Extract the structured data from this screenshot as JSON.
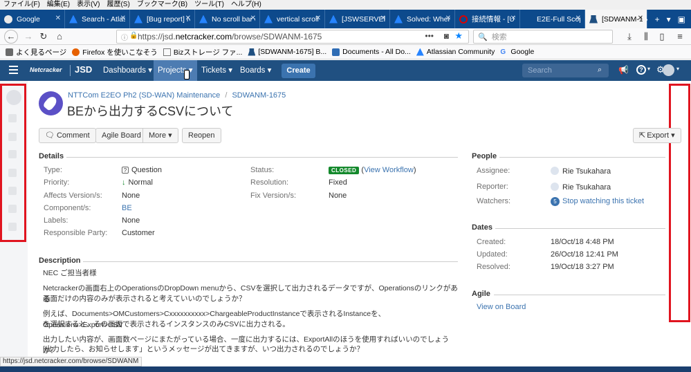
{
  "browser": {
    "menu": [
      "ファイル(F)",
      "編集(E)",
      "表示(V)",
      "履歴(S)",
      "ブックマーク(B)",
      "ツール(T)",
      "ヘルプ(H)"
    ],
    "tabs": [
      {
        "title": "Google",
        "icon": "google-icon"
      },
      {
        "title": "Search - Atlassi",
        "icon": "atlassian-icon"
      },
      {
        "title": "[Bug report] N",
        "icon": "atlassian-icon"
      },
      {
        "title": "No scroll bar or",
        "icon": "atlassian-icon"
      },
      {
        "title": "vertical scroll b",
        "icon": "atlassian-icon"
      },
      {
        "title": "[JSWSERVER-1",
        "icon": "atlassian-icon"
      },
      {
        "title": "Solved: Where'",
        "icon": "atlassian-icon"
      },
      {
        "title": "接続情報 - [UT",
        "icon": "red-circle-icon"
      },
      {
        "title": "E2E-Full Scope",
        "icon": "e2e-icon"
      },
      {
        "title": "[SDWANM-1",
        "icon": "jsd-icon",
        "active": true
      }
    ],
    "url_prefix": "https://jsd.",
    "url_domain": "netcracker.com",
    "url_path": "/browse/SDWANM-1675",
    "search_placeholder": "検索",
    "bookmarks": [
      "よく見るページ",
      "Firefox を使いこなそう",
      "Bizストレージ ファ...",
      "[SDWANM-1675] B...",
      "Documents - All Do...",
      "Atlassian Community",
      "Google"
    ],
    "status_url": "https://jsd.netcracker.com/browse/SDWANM"
  },
  "jira": {
    "brand": "Netcracker",
    "product": "JSD",
    "menu": [
      "Dashboards ▾",
      "Projects ▾",
      "Tickets ▾",
      "Boards ▾"
    ],
    "create": "Create",
    "search_placeholder": "Search"
  },
  "issue": {
    "project": "NTTCom E2EO Ph2 (SD-WAN) Maintenance",
    "key": "SDWANM-1675",
    "title": "BEから出力するCSVについて",
    "actions": {
      "comment": "Comment",
      "agile": "Agile Board",
      "more": "More ▾",
      "reopen": "Reopen",
      "export": "Export ▾"
    },
    "details_heading": "Details",
    "details": [
      {
        "label": "Type:",
        "value": "Question"
      },
      {
        "label": "Priority:",
        "value": "Normal"
      },
      {
        "label": "Affects Version/s:",
        "value": "None"
      },
      {
        "label": "Component/s:",
        "value": "BE"
      },
      {
        "label": "Labels:",
        "value": "None"
      },
      {
        "label": "Responsible Party:",
        "value": "Customer"
      }
    ],
    "details_right": [
      {
        "label": "Status:",
        "badge": "CLOSED",
        "link": "View Workflow"
      },
      {
        "label": "Resolution:",
        "value": "Fixed"
      },
      {
        "label": "Fix Version/s:",
        "value": "None"
      }
    ],
    "description_heading": "Description",
    "description": [
      "NEC ご担当者様",
      "Netcrackerの画面右上のOperationsのDropDown menuから、CSVを選択して出力されるデータですが、Operationsのリンクがある",
      "画面だけの内容のみが表示されると考えていいのでしょうか？",
      "例えば、Documents>OMCustomers>Cxxxxxxxxxx>ChargeableProductInstanceで表示されるInstanceを、Operations>Export>CSV",
      "を選択すると、その画面で表示されるインスタンスのみCSVに出力される。",
      "出力したい内容が、画面数ページにまたがっている場合、一度に出力するには、ExportAllのほうを使用すればいいのでしょうか？",
      "[出力したら、お知らせします」というメッセージが出てきますが、いつ出力されるのでしょうか？"
    ],
    "people_heading": "People",
    "people": [
      {
        "label": "Assignee:",
        "value": "Rie Tsukahara"
      },
      {
        "label": "Reporter:",
        "value": "Rie Tsukahara"
      },
      {
        "label": "Watchers:",
        "count": "5",
        "link": "Stop watching this ticket"
      }
    ],
    "dates_heading": "Dates",
    "dates": [
      {
        "label": "Created:",
        "value": "18/Oct/18 4:48 PM"
      },
      {
        "label": "Updated:",
        "value": "26/Oct/18 12:41 PM"
      },
      {
        "label": "Resolved:",
        "value": "19/Oct/18 3:27 PM"
      }
    ],
    "agile_heading": "Agile",
    "agile_link": "View on Board"
  },
  "colors": {
    "jira_header": "#205081",
    "closed_badge": "#14892c",
    "highlight_box": "#e0141f",
    "tab_bar": "#0d4a8c"
  }
}
